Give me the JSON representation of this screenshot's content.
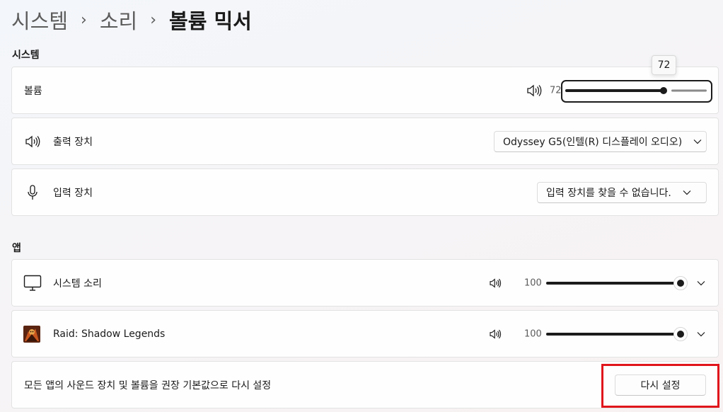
{
  "breadcrumb": {
    "items": [
      "시스템",
      "소리"
    ],
    "current": "볼륨 믹서",
    "separator": "›"
  },
  "system_section": {
    "title": "시스템",
    "volume": {
      "label": "볼륨",
      "value_text": "72",
      "value": 72,
      "tooltip": "72"
    },
    "output": {
      "label": "출력 장치",
      "selected": "Odyssey G5(인텔(R) 디스플레이 오디오)",
      "icon": "speaker-icon"
    },
    "input": {
      "label": "입력 장치",
      "selected": "입력 장치를 찾을 수 없습니다.",
      "icon": "microphone-icon"
    }
  },
  "apps_section": {
    "title": "앱",
    "apps": [
      {
        "name": "시스템 소리",
        "volume_text": "100",
        "volume": 100,
        "icon": "monitor-icon"
      },
      {
        "name": "Raid: Shadow Legends",
        "volume_text": "100",
        "volume": 100,
        "icon": "game-app-icon"
      }
    ]
  },
  "reset": {
    "label": "모든 앱의 사운드 장치 및 볼륨을 권장 기본값으로 다시 설정",
    "button": "다시 설정"
  },
  "colors": {
    "accent": "#1b1b1b",
    "highlight": "#e0151b",
    "track_filled": "#1b1b1b",
    "track_empty": "#8a8a8a"
  }
}
